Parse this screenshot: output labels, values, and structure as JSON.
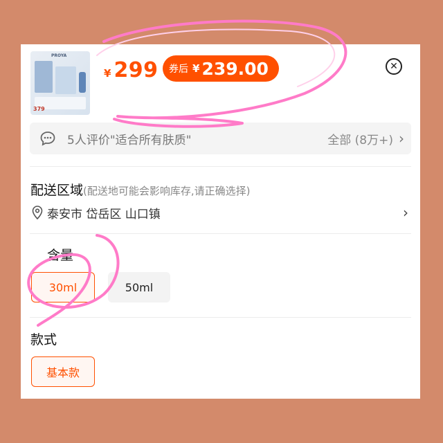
{
  "product": {
    "thumbnail_brand": "PROYA",
    "thumbnail_price": "379",
    "price_symbol": "¥",
    "price": "299",
    "coupon_label": "券后",
    "coupon_symbol": "¥",
    "coupon_price": "239.00"
  },
  "review": {
    "text": "5人评价\"适合所有肤质\"",
    "all_label": "全部 (8万+)"
  },
  "delivery": {
    "title": "配送区域",
    "hint": "(配送地可能会影响库存,请正确选择)",
    "address": "泰安市 岱岳区 山口镇"
  },
  "volume": {
    "title": "含量",
    "options": [
      {
        "label": "30ml",
        "selected": true
      },
      {
        "label": "50ml",
        "selected": false
      }
    ]
  },
  "style": {
    "title": "款式",
    "options": [
      {
        "label": "基本款",
        "selected": true
      }
    ]
  },
  "colors": {
    "accent": "#ff5000",
    "background": "#D38A6B",
    "annotation": "#ff7bc8"
  }
}
